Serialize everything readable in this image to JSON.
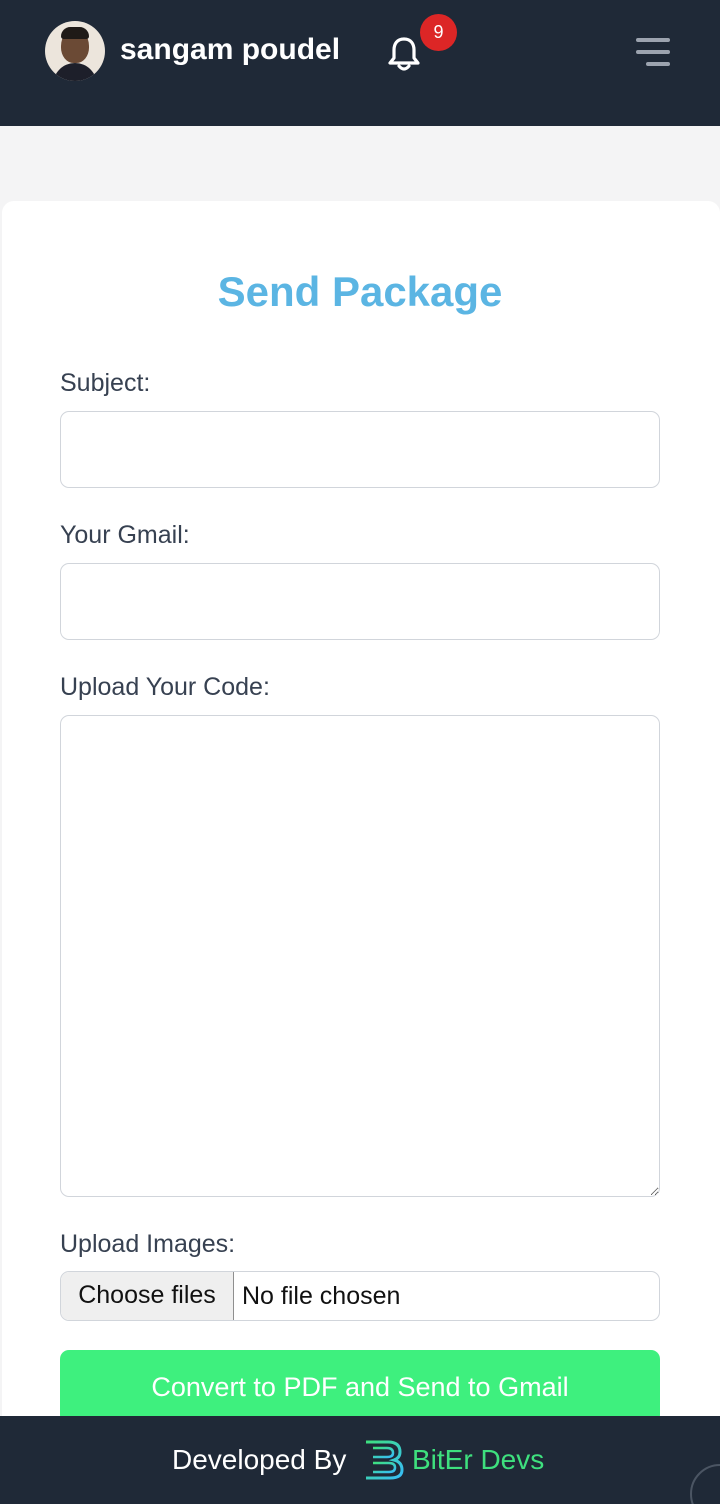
{
  "header": {
    "username": "sangam poudel",
    "notification_count": "9",
    "avatar_alt": "profile photo"
  },
  "form": {
    "title": "Send Package",
    "subject_label": "Subject:",
    "subject_value": "",
    "gmail_label": "Your Gmail:",
    "gmail_value": "",
    "code_label": "Upload Your Code:",
    "code_value": "",
    "images_label": "Upload Images:",
    "choose_files_label": "Choose files",
    "file_status": "No file chosen",
    "submit_label": "Convert to PDF and Send to Gmail"
  },
  "footer": {
    "developed_by": "Developed By",
    "brand_name": "BitEr Devs"
  },
  "colors": {
    "header_bg": "#1f2937",
    "title": "#5bb5e3",
    "submit_bg": "#3ef07e",
    "badge": "#dc2626",
    "brand": "#3ee07e"
  }
}
